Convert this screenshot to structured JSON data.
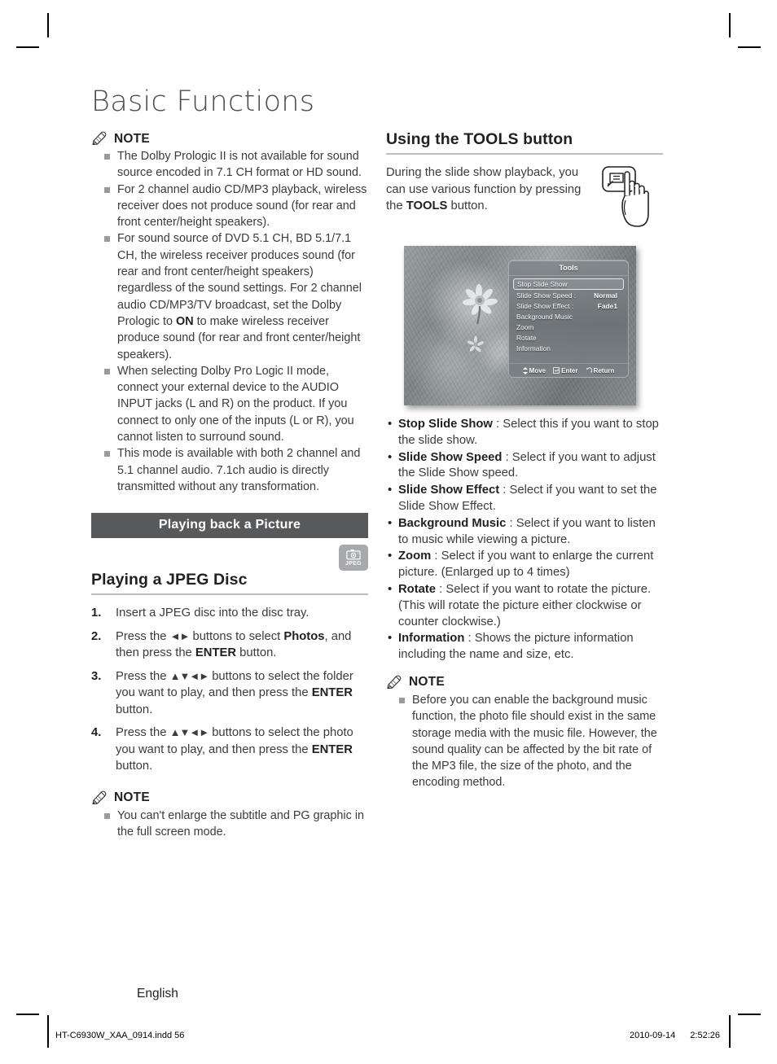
{
  "page": {
    "title": "Basic Functions",
    "language_label": "English"
  },
  "footer": {
    "file": "HT-C6930W_XAA_0914.indd   56",
    "date": "2010-09-14",
    "time": "2:52:26"
  },
  "left_column": {
    "note1": {
      "label": "NOTE",
      "icon": "pencil-icon",
      "items": [
        "The Dolby Prologic II is not available for sound source encoded in 7.1 CH format or HD sound.",
        "For 2 channel audio CD/MP3 playback, wireless receiver does not produce sound (for rear and front center/height speakers).",
        "For sound source of DVD 5.1 CH, BD 5.1/7.1 CH, the wireless receiver produces sound (for rear and front center/height speakers) regardless of the sound settings. For 2 channel audio CD/MP3/TV broadcast, set the Dolby Prologic to ON to make wireless receiver produce sound (for rear and front center/height speakers).",
        "When selecting Dolby Pro Logic II mode, connect your external device to the AUDIO INPUT jacks (L and R) on the product. If you connect to only one of the inputs (L or R), you cannot listen to surround sound.",
        "This mode is available with both 2 channel and 5.1 channel audio. 7.1ch audio is directly transmitted without any transformation."
      ]
    },
    "section_bar": "Playing back a Picture",
    "badge": {
      "label": "JPEG",
      "icon": "camera-icon"
    },
    "heading": "Playing a JPEG Disc",
    "steps": [
      {
        "num": "1.",
        "text": "Insert a JPEG disc into the disc tray."
      },
      {
        "num": "2.",
        "text": "Press the ◄► buttons to select Photos, and then press the ENTER button."
      },
      {
        "num": "3.",
        "text": "Press the ▲▼◄► buttons to select the folder you want to play, and then press the ENTER button."
      },
      {
        "num": "4.",
        "text": "Press the ▲▼◄► buttons to select the photo you want to play, and then press the ENTER button."
      }
    ],
    "note2": {
      "label": "NOTE",
      "icon": "pencil-icon",
      "items": [
        "You can't enlarge the subtitle and PG graphic in the full screen mode."
      ]
    }
  },
  "right_column": {
    "heading": "Using the TOOLS button",
    "intro": "During the slide show playback, you can use various function by pressing the TOOLS button.",
    "remote_illustration_icon": "hand-pressing-tools-button-icon",
    "tv_screen": {
      "panel_title": "Tools",
      "items": [
        {
          "label": "Stop Slide Show",
          "value": "",
          "selected": true
        },
        {
          "label": "Slide Show Speed  :",
          "value": "Normal",
          "selected": false
        },
        {
          "label": "Slide Show Effect  :",
          "value": "Fade1",
          "selected": false
        },
        {
          "label": "Background Music",
          "value": "",
          "selected": false
        },
        {
          "label": "Zoom",
          "value": "",
          "selected": false
        },
        {
          "label": "Rotate",
          "value": "",
          "selected": false
        },
        {
          "label": "Information",
          "value": "",
          "selected": false
        }
      ],
      "footer_hints": [
        {
          "icon": "up-down-arrow-icon",
          "label": "Move"
        },
        {
          "icon": "enter-icon",
          "label": "Enter"
        },
        {
          "icon": "return-icon",
          "label": "Return"
        }
      ]
    },
    "definitions": [
      {
        "term": "Stop Slide Show",
        "sep": " : ",
        "desc": "Select this if you want to stop the slide show."
      },
      {
        "term": "Slide Show Speed",
        "sep": " : ",
        "desc": "Select if you want to adjust the Slide Show speed."
      },
      {
        "term": "Slide Show Effect",
        "sep": " : ",
        "desc": "Select if you want to set the Slide Show Effect."
      },
      {
        "term": "Background Music",
        "sep": " : ",
        "desc": "Select if you want to listen to music while viewing a picture."
      },
      {
        "term": "Zoom",
        "sep": " : ",
        "desc": "Select if you want to enlarge the current picture. (Enlarged up to 4 times)"
      },
      {
        "term": "Rotate",
        "sep": " : ",
        "desc": "Select if you want to rotate the picture. (This will rotate the picture either clockwise or counter clockwise.)"
      },
      {
        "term": "Information",
        "sep": " : ",
        "desc": "Shows the picture information including the name and size, etc."
      }
    ],
    "note": {
      "label": "NOTE",
      "icon": "pencil-icon",
      "items": [
        "Before you can enable the background music function, the photo file should exist in the same storage media with the music file. However, the sound quality can be affected by the bit rate of the MP3 file, the size of the photo, and the encoding method."
      ]
    }
  },
  "colors": {
    "section_bar_bg": "#58595b",
    "badge_bg": "#a7a9ac",
    "rule": "#bcbdc0",
    "body_text": "#3b3b3b",
    "title_text": "#4d4d4d"
  }
}
